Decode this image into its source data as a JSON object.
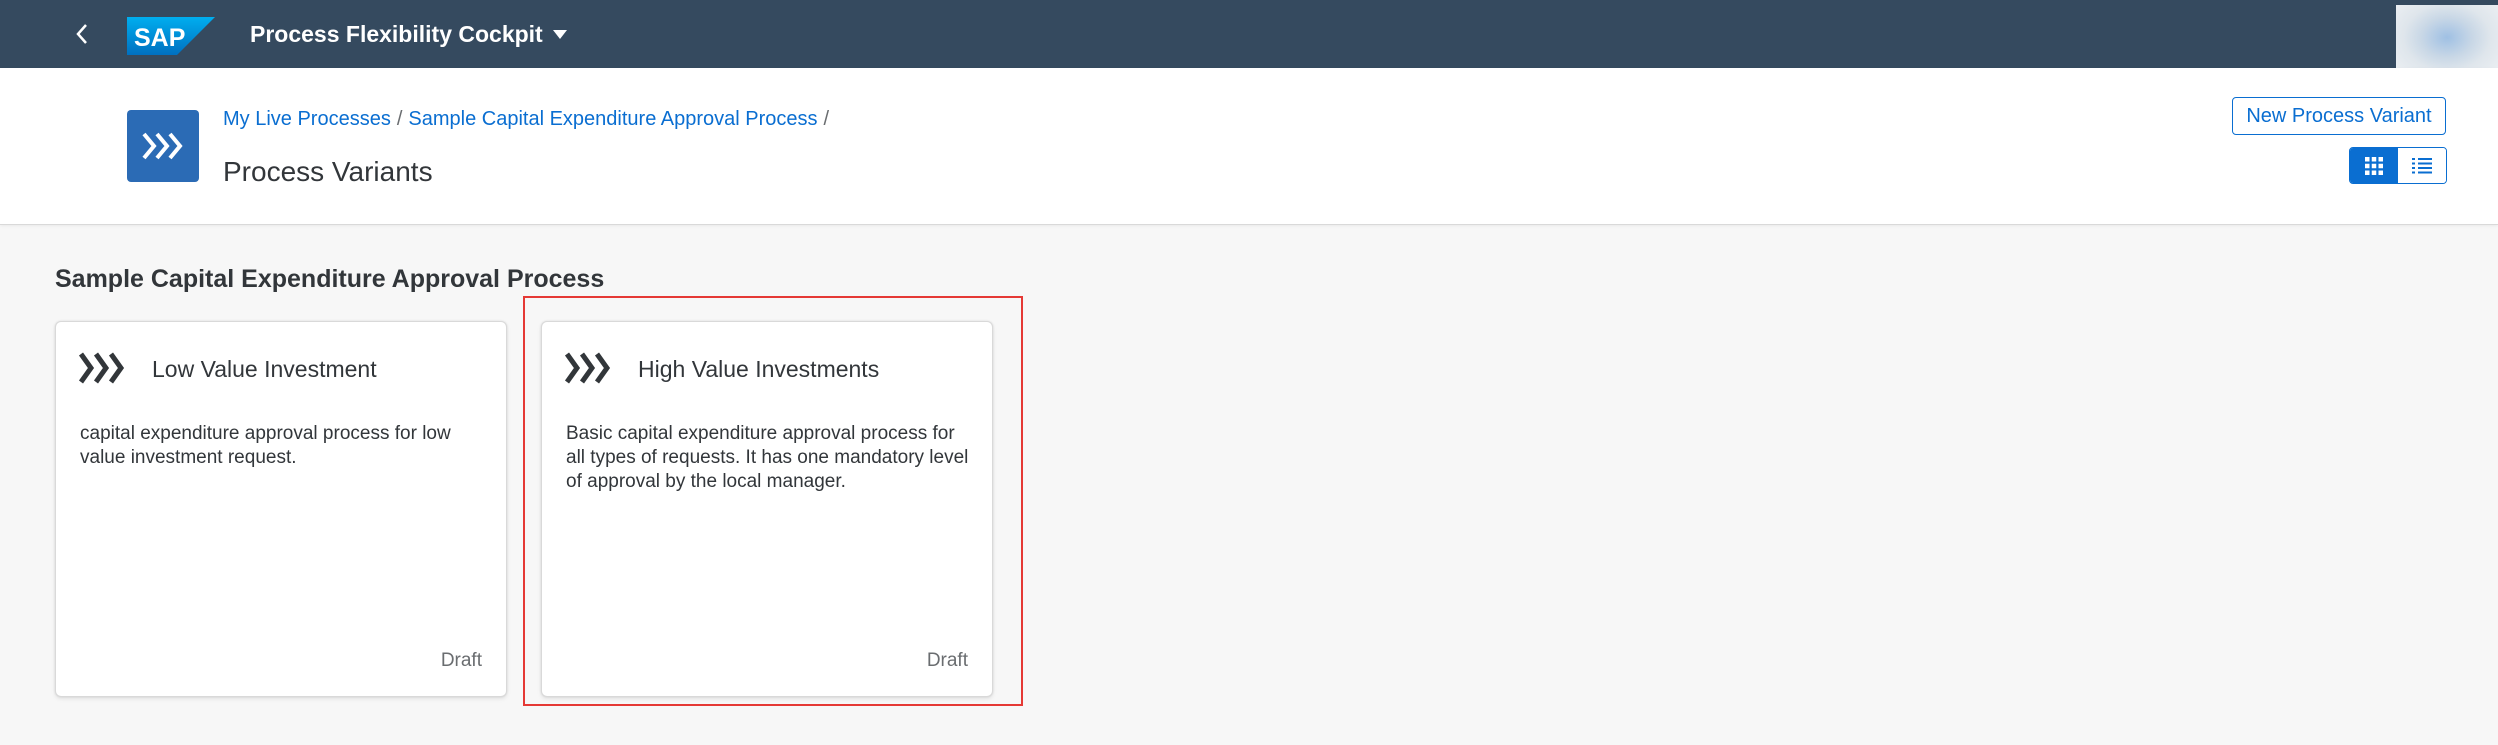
{
  "shell": {
    "app_title": "Process Flexibility Cockpit",
    "logo_text": "SAP",
    "icons": [
      "back-icon",
      "sap-logo",
      "dropdown-caret-icon",
      "avatar"
    ]
  },
  "header": {
    "breadcrumb": [
      {
        "label": "My Live Processes"
      },
      {
        "label": "Sample Capital Expenditure Approval Process"
      }
    ],
    "separator": "/",
    "title": "Process Variants",
    "new_variant_label": "New Process Variant",
    "view_modes": [
      "grid-view-icon",
      "list-view-icon"
    ],
    "active_view": "grid"
  },
  "section": {
    "title": "Sample Capital Expenditure Approval Process"
  },
  "cards": [
    {
      "title": "Low Value Investment",
      "description": "capital expenditure approval process for low value investment request.",
      "status": "Draft"
    },
    {
      "title": "High Value Investments",
      "description": "Basic capital expenditure approval process for all types of requests. It has one mandatory level of approval by the local manager.",
      "status": "Draft",
      "highlighted": true
    }
  ],
  "colors": {
    "shell_bg": "#354a5f",
    "accent": "#0a6ed1",
    "page_icon_bg": "#2b6bb5",
    "highlight_border": "#e53935",
    "page_bg": "#f7f7f7"
  }
}
